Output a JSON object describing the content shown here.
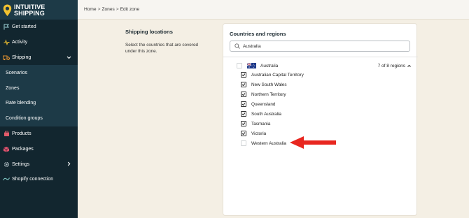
{
  "brand": {
    "name_line1": "INTUITIVE",
    "name_line2": "SHIPPING",
    "accent": "#f2c230"
  },
  "sidebar": {
    "items": [
      {
        "label": "Get started",
        "icon": "flag-icon"
      },
      {
        "label": "Activity",
        "icon": "activity-icon"
      },
      {
        "label": "Shipping",
        "icon": "truck-icon",
        "expanded": true
      },
      {
        "label": "Scenarios"
      },
      {
        "label": "Zones"
      },
      {
        "label": "Rate blending"
      },
      {
        "label": "Condition groups"
      },
      {
        "label": "Products",
        "icon": "products-icon"
      },
      {
        "label": "Packages",
        "icon": "package-icon"
      },
      {
        "label": "Settings",
        "icon": "gear-icon"
      },
      {
        "label": "Shopify connection",
        "icon": "shopify-icon"
      }
    ]
  },
  "breadcrumb": {
    "home": "Home",
    "zones": "Zones",
    "current": "Edit zone",
    "separator": ">"
  },
  "section": {
    "title": "Shipping locations",
    "description": "Select the countries that are covered under this zone."
  },
  "card": {
    "title": "Countries and regions",
    "search_value": "Australia",
    "country": {
      "name": "Australia",
      "regions_selected": "7 of 8 regions"
    },
    "regions": [
      {
        "name": "Australian Capital Territory",
        "checked": true
      },
      {
        "name": "New South Wales",
        "checked": true
      },
      {
        "name": "Northern Territory",
        "checked": true
      },
      {
        "name": "Queensland",
        "checked": true
      },
      {
        "name": "South Australia",
        "checked": true
      },
      {
        "name": "Tasmania",
        "checked": true
      },
      {
        "name": "Victoria",
        "checked": true
      },
      {
        "name": "Western Australia",
        "checked": false
      }
    ]
  },
  "colors": {
    "sidebar": "#1d3a47",
    "sidebar_active": "#12262f",
    "background": "#f4efe4",
    "arrow": "#e8261f"
  }
}
